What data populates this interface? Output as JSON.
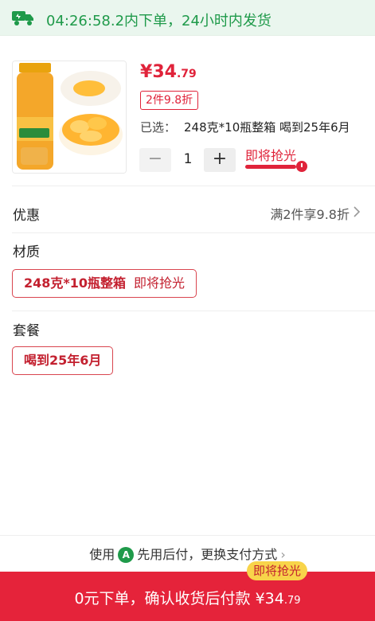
{
  "top_notice": {
    "text": "04:26:58.2内下单，24小时内发货"
  },
  "product": {
    "price_currency": "¥",
    "price_main": "34",
    "price_decimal": ".79",
    "discount_badge": "2件9.8折",
    "selected_label": "已选：",
    "selected_value": "248克*10瓶整箱 喝到25年6月",
    "quantity": "1",
    "minus_symbol": "−",
    "plus_symbol": "+",
    "soon_label": "即将抢光",
    "soon_progress": 0.8
  },
  "promo": {
    "title": "优惠",
    "value": "满2件享9.8折"
  },
  "material": {
    "title": "材质",
    "option_label": "248克*10瓶整箱",
    "option_sub": "即将抢光"
  },
  "package": {
    "title": "套餐",
    "option_label": "喝到25年6月"
  },
  "payment_row": {
    "prefix": "使用",
    "icon_letter": "A",
    "text": "先用后付，更换支付方式"
  },
  "cta": {
    "badge": "即将抢光",
    "label_text": "0元下单，确认收货后付款 ",
    "price_currency": "¥",
    "price_main": "34",
    "price_decimal": ".79"
  },
  "colors": {
    "accent_red": "#e5233a",
    "green": "#1f9a4a",
    "badge_yellow": "#f8d44a"
  },
  "icons": [
    "truck-icon",
    "product-image",
    "chevron-right-icon",
    "pay-later-icon",
    "clock-icon"
  ]
}
